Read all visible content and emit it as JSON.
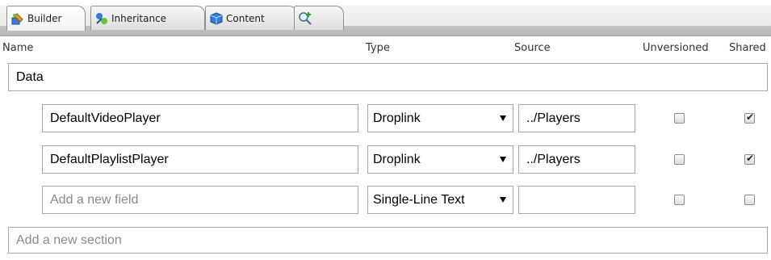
{
  "tabs": [
    {
      "label": "Builder",
      "icon": "builder-icon",
      "active": true
    },
    {
      "label": "Inheritance",
      "icon": "inheritance-icon",
      "active": false
    },
    {
      "label": "Content",
      "icon": "content-cube-icon",
      "active": false
    },
    {
      "label": "",
      "icon": "add-tab-magnifier-icon",
      "active": false
    }
  ],
  "columns": {
    "name": "Name",
    "type": "Type",
    "source": "Source",
    "unversioned": "Unversioned",
    "shared": "Shared"
  },
  "section": {
    "name": "Data"
  },
  "fields": [
    {
      "name": "DefaultVideoPlayer",
      "type": "Droplink",
      "source": "../Players",
      "unversioned": false,
      "shared": true
    },
    {
      "name": "DefaultPlaylistPlayer",
      "type": "Droplink",
      "source": "../Players",
      "unversioned": false,
      "shared": true
    }
  ],
  "new_field": {
    "placeholder": "Add a new field",
    "type": "Single-Line Text",
    "source": "",
    "unversioned": false,
    "shared": false
  },
  "new_section": {
    "placeholder": "Add a new section"
  }
}
